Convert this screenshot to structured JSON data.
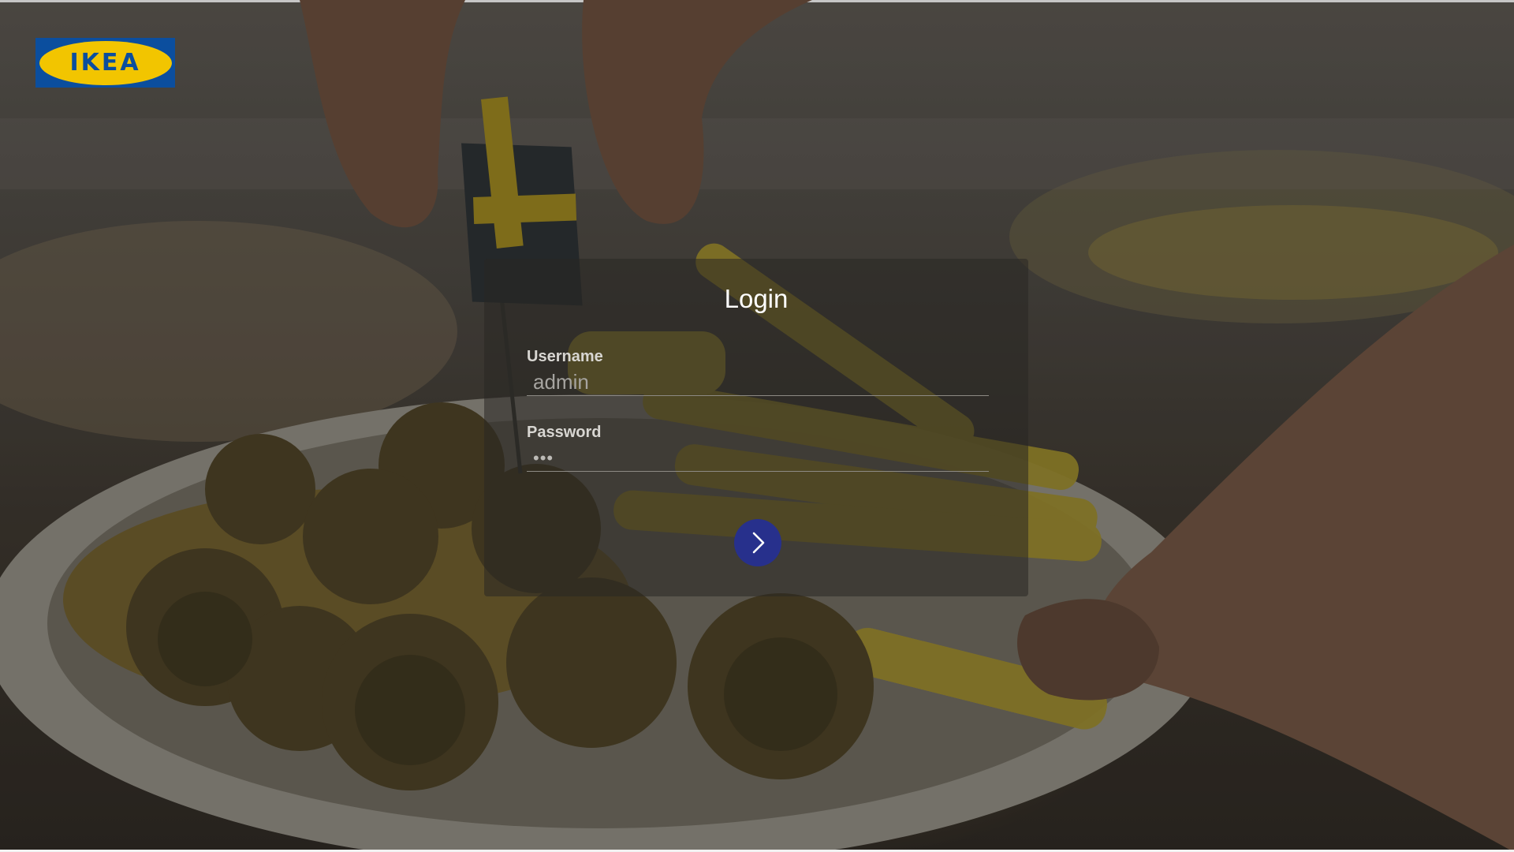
{
  "brand": {
    "logo_text": "IKEA",
    "blue": "#0b4e9e",
    "yellow": "#f2c500"
  },
  "login": {
    "title": "Login",
    "username": {
      "label": "Username",
      "value": "admin"
    },
    "password": {
      "label": "Password",
      "value": "•••"
    },
    "submit_icon": "chevron-right-icon",
    "submit_color": "#27308c"
  }
}
